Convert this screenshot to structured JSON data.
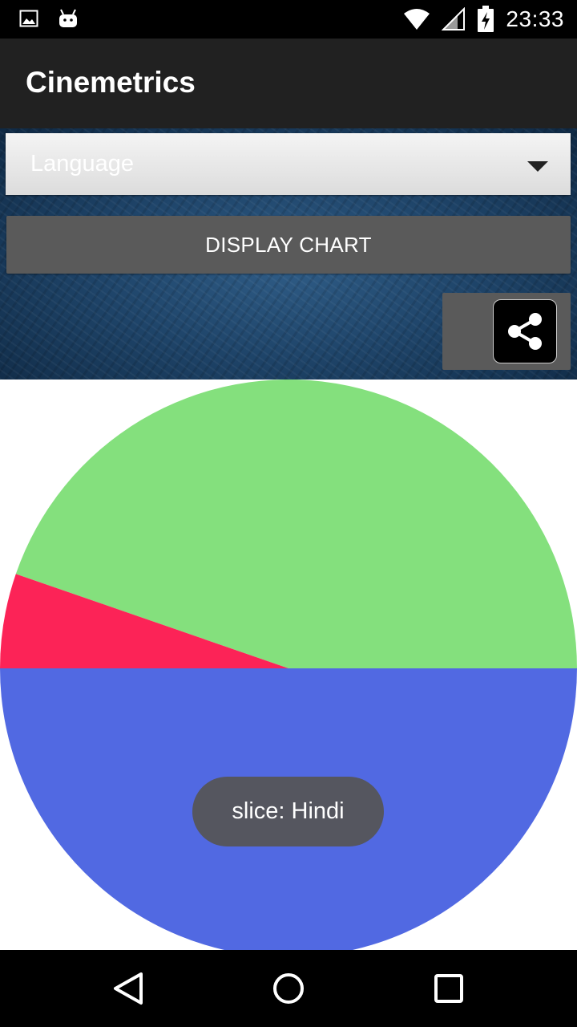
{
  "status_bar": {
    "time": "23:33",
    "icons": [
      "image-notification-icon",
      "android-notification-icon",
      "wifi-icon",
      "signal-icon",
      "battery-charging-icon"
    ]
  },
  "app_bar": {
    "title": "Cinemetrics"
  },
  "spinner": {
    "selected_value": "Language"
  },
  "display_button": {
    "label": "DISPLAY CHART"
  },
  "share_button": {
    "icon": "share-icon"
  },
  "chart_data": {
    "type": "pie",
    "title": "",
    "slices": [
      {
        "label": "",
        "value": 44.7,
        "color": "#84e07d"
      },
      {
        "label": "",
        "value": 5.3,
        "color": "#fc2357"
      },
      {
        "label": "Hindi",
        "value": 50,
        "color": "#5169e2"
      }
    ]
  },
  "toast": {
    "text": "slice: Hindi"
  },
  "nav_bar": {
    "icons": [
      "back-icon",
      "home-icon",
      "recents-icon"
    ]
  }
}
